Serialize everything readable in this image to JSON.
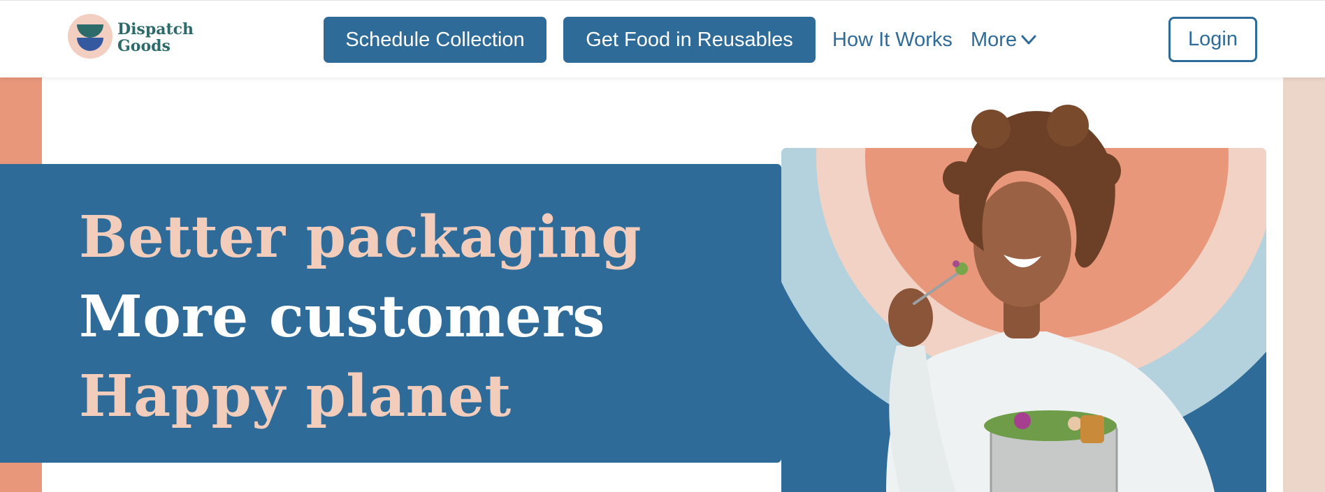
{
  "header": {
    "logo_text": "Dispatch\nGoods",
    "nav": {
      "schedule_label": "Schedule Collection",
      "food_label": "Get Food in Reusables",
      "how_label": "How It Works",
      "more_label": "More",
      "login_label": "Login"
    }
  },
  "hero": {
    "lines": [
      "Better packaging",
      "More customers",
      "Happy planet"
    ]
  },
  "colors": {
    "brand_blue": "#2e6b98",
    "peach": "#f3cdbc",
    "coral": "#e8977a",
    "light_blue": "#b3d2dd",
    "logo_teal": "#2d6a6a"
  },
  "icons": {
    "more": "chevron-down-icon"
  }
}
